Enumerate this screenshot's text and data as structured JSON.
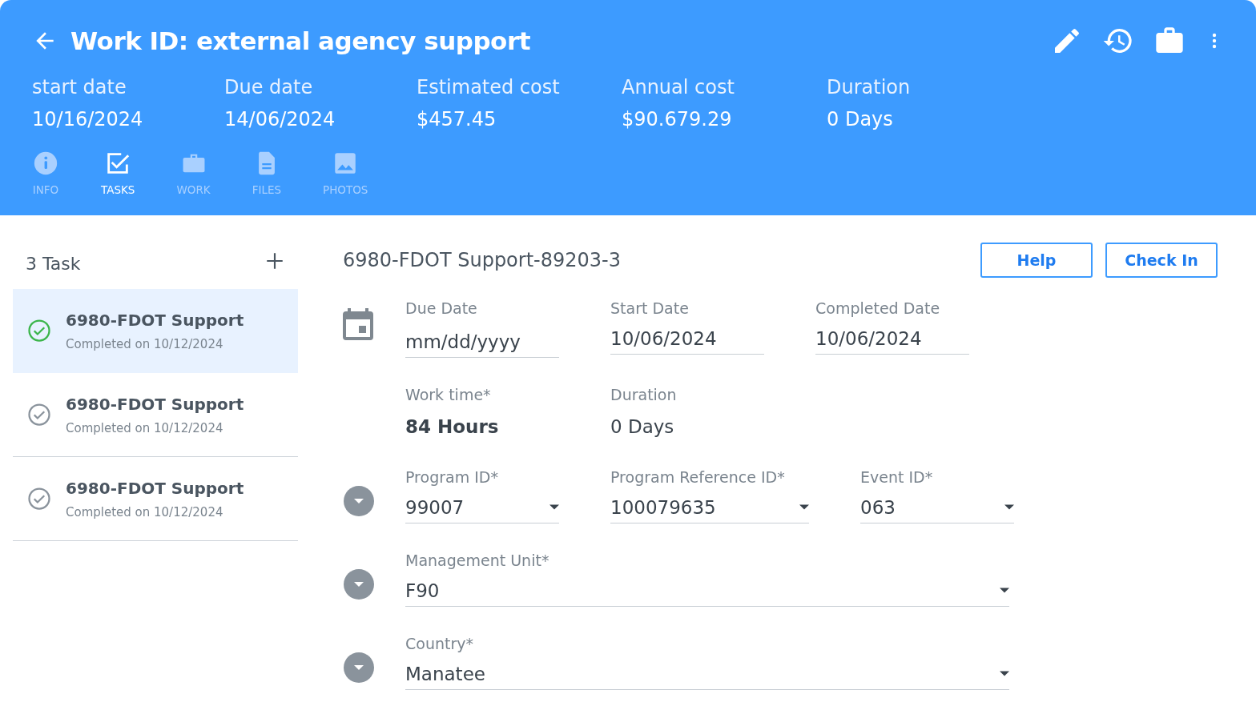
{
  "header": {
    "title": "Work ID: external agency support",
    "stats": [
      {
        "label": "start date",
        "value": "10/16/2024"
      },
      {
        "label": "Due date",
        "value": "14/06/2024"
      },
      {
        "label": "Estimated cost",
        "value": "$457.45"
      },
      {
        "label": "Annual cost",
        "value": "$90.679.29"
      },
      {
        "label": "Duration",
        "value": "0 Days"
      }
    ],
    "tabs": [
      {
        "label": "INFO",
        "kind": "info",
        "selected": false
      },
      {
        "label": "TASKS",
        "kind": "tasks",
        "selected": true
      },
      {
        "label": "WORK",
        "kind": "work",
        "selected": false
      },
      {
        "label": "FILES",
        "kind": "files",
        "selected": false
      },
      {
        "label": "PHOTOS",
        "kind": "photos",
        "selected": false
      }
    ]
  },
  "task_list": {
    "title": "3 Task",
    "tasks": [
      {
        "name": "6980-FDOT Support",
        "subtitle": "Completed on 10/12/2024",
        "selected": true
      },
      {
        "name": "6980-FDOT Support",
        "subtitle": "Completed on 10/12/2024",
        "selected": false
      },
      {
        "name": "6980-FDOT Support",
        "subtitle": "Completed on 10/12/2024",
        "selected": false
      }
    ]
  },
  "detail": {
    "title": "6980-FDOT Support-89203-3",
    "buttons": [
      "Help",
      "Check In"
    ],
    "sections": [
      {
        "kind": "date",
        "fields": [
          {
            "kind": "input",
            "label": "Due Date",
            "placeholder": "mm/dd/yyyy"
          },
          {
            "kind": "input",
            "label": "Start Date",
            "value": "10/06/2024"
          },
          {
            "kind": "input",
            "label": "Completed Date",
            "value": "10/06/2024"
          }
        ]
      },
      {
        "kind": "plain",
        "fields": [
          {
            "kind": "text",
            "label": "Work time*",
            "value": "84 Hours"
          },
          {
            "kind": "text",
            "label": "Duration",
            "value": "0 Days"
          }
        ]
      },
      {
        "kind": "select",
        "fields": [
          {
            "kind": "select",
            "label": "Program ID*",
            "value": "99007"
          },
          {
            "kind": "select",
            "label": "Program Reference ID*",
            "value": "100079635"
          },
          {
            "kind": "select",
            "label": "Event ID*",
            "value": "063"
          }
        ]
      },
      {
        "kind": "select",
        "fields": [
          {
            "kind": "select",
            "label": "Management Unit*",
            "value": "F90"
          }
        ]
      },
      {
        "kind": "select",
        "fields": [
          {
            "kind": "select",
            "label": "Country*",
            "value": "Manatee"
          }
        ]
      }
    ]
  }
}
